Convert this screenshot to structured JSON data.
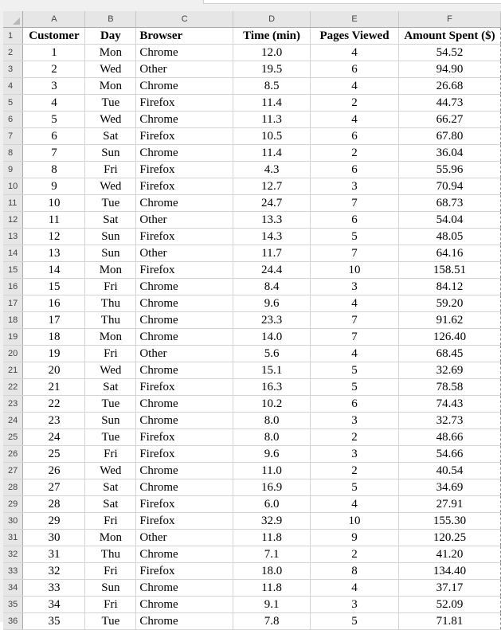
{
  "columns": [
    "A",
    "B",
    "C",
    "D",
    "E",
    "F"
  ],
  "headers": [
    "Customer",
    "Day",
    "Browser",
    "Time (min)",
    "Pages Viewed",
    "Amount Spent ($)"
  ],
  "rows": [
    [
      "1",
      "Mon",
      "Chrome",
      "12.0",
      "4",
      "54.52"
    ],
    [
      "2",
      "Wed",
      "Other",
      "19.5",
      "6",
      "94.90"
    ],
    [
      "3",
      "Mon",
      "Chrome",
      "8.5",
      "4",
      "26.68"
    ],
    [
      "4",
      "Tue",
      "Firefox",
      "11.4",
      "2",
      "44.73"
    ],
    [
      "5",
      "Wed",
      "Chrome",
      "11.3",
      "4",
      "66.27"
    ],
    [
      "6",
      "Sat",
      "Firefox",
      "10.5",
      "6",
      "67.80"
    ],
    [
      "7",
      "Sun",
      "Chrome",
      "11.4",
      "2",
      "36.04"
    ],
    [
      "8",
      "Fri",
      "Firefox",
      "4.3",
      "6",
      "55.96"
    ],
    [
      "9",
      "Wed",
      "Firefox",
      "12.7",
      "3",
      "70.94"
    ],
    [
      "10",
      "Tue",
      "Chrome",
      "24.7",
      "7",
      "68.73"
    ],
    [
      "11",
      "Sat",
      "Other",
      "13.3",
      "6",
      "54.04"
    ],
    [
      "12",
      "Sun",
      "Firefox",
      "14.3",
      "5",
      "48.05"
    ],
    [
      "13",
      "Sun",
      "Other",
      "11.7",
      "7",
      "64.16"
    ],
    [
      "14",
      "Mon",
      "Firefox",
      "24.4",
      "10",
      "158.51"
    ],
    [
      "15",
      "Fri",
      "Chrome",
      "8.4",
      "3",
      "84.12"
    ],
    [
      "16",
      "Thu",
      "Chrome",
      "9.6",
      "4",
      "59.20"
    ],
    [
      "17",
      "Thu",
      "Chrome",
      "23.3",
      "7",
      "91.62"
    ],
    [
      "18",
      "Mon",
      "Chrome",
      "14.0",
      "7",
      "126.40"
    ],
    [
      "19",
      "Fri",
      "Other",
      "5.6",
      "4",
      "68.45"
    ],
    [
      "20",
      "Wed",
      "Chrome",
      "15.1",
      "5",
      "32.69"
    ],
    [
      "21",
      "Sat",
      "Firefox",
      "16.3",
      "5",
      "78.58"
    ],
    [
      "22",
      "Tue",
      "Chrome",
      "10.2",
      "6",
      "74.43"
    ],
    [
      "23",
      "Sun",
      "Chrome",
      "8.0",
      "3",
      "32.73"
    ],
    [
      "24",
      "Tue",
      "Firefox",
      "8.0",
      "2",
      "48.66"
    ],
    [
      "25",
      "Fri",
      "Firefox",
      "9.6",
      "3",
      "54.66"
    ],
    [
      "26",
      "Wed",
      "Chrome",
      "11.0",
      "2",
      "40.54"
    ],
    [
      "27",
      "Sat",
      "Chrome",
      "16.9",
      "5",
      "34.69"
    ],
    [
      "28",
      "Sat",
      "Firefox",
      "6.0",
      "4",
      "27.91"
    ],
    [
      "29",
      "Fri",
      "Firefox",
      "32.9",
      "10",
      "155.30"
    ],
    [
      "30",
      "Mon",
      "Other",
      "11.8",
      "9",
      "120.25"
    ],
    [
      "31",
      "Thu",
      "Chrome",
      "7.1",
      "2",
      "41.20"
    ],
    [
      "32",
      "Fri",
      "Firefox",
      "18.0",
      "8",
      "134.40"
    ],
    [
      "33",
      "Sun",
      "Chrome",
      "11.8",
      "4",
      "37.17"
    ],
    [
      "34",
      "Fri",
      "Chrome",
      "9.1",
      "3",
      "52.09"
    ],
    [
      "35",
      "Tue",
      "Chrome",
      "7.8",
      "5",
      "71.81"
    ]
  ]
}
